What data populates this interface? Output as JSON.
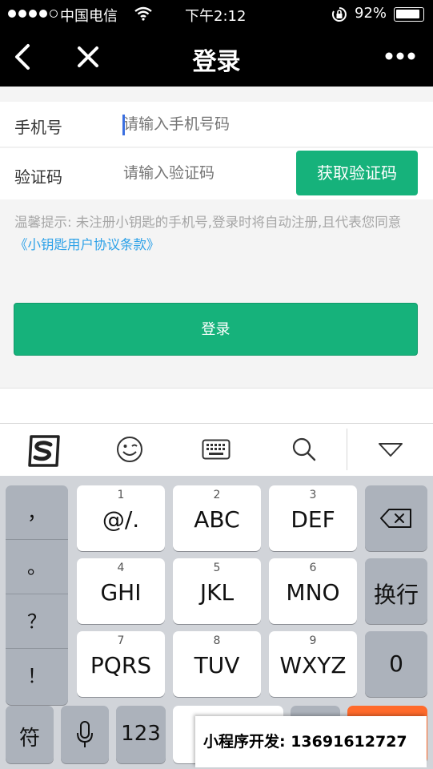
{
  "status_bar": {
    "carrier": "中国电信",
    "time": "下午2:12",
    "battery": "92%",
    "battery_level": 0.92
  },
  "nav": {
    "title": "登录",
    "back_icon": "chevron-left-icon",
    "close_icon": "close-icon",
    "more_icon": "more-icon"
  },
  "form": {
    "phone_label": "手机号",
    "phone_placeholder": "请输入手机号码",
    "code_label": "验证码",
    "code_placeholder": "请输入验证码",
    "get_code_button": "获取验证码",
    "hint_text": "温馨提示: 未注册小钥匙的手机号,登录时将自动注册,且代表您同意 ",
    "agreement_link": "《小钥匙用户协议条款》",
    "login_button": "登录"
  },
  "colors": {
    "accent": "#16b27b",
    "link": "#2fa2e8",
    "nav_bg": "#000000"
  },
  "keyboard": {
    "toolbar_icons": [
      "sogou-logo-icon",
      "emoji-icon",
      "keyboard-icon",
      "search-icon",
      "hide-keyboard-icon"
    ],
    "symbols": [
      "，",
      "。",
      "？",
      "！"
    ],
    "keys": [
      {
        "num": "1",
        "label": "@/."
      },
      {
        "num": "2",
        "label": "ABC"
      },
      {
        "num": "3",
        "label": "DEF"
      },
      {
        "num": "4",
        "label": "GHI"
      },
      {
        "num": "5",
        "label": "JKL"
      },
      {
        "num": "6",
        "label": "MNO"
      },
      {
        "num": "7",
        "label": "PQRS"
      },
      {
        "num": "8",
        "label": "TUV"
      },
      {
        "num": "9",
        "label": "WXYZ"
      }
    ],
    "enter_label": "换行",
    "zero_label": "0",
    "fu_label": "符",
    "num_switch_label": "123"
  },
  "promo_overlay": {
    "text": "小程序开发:  13691612727"
  }
}
